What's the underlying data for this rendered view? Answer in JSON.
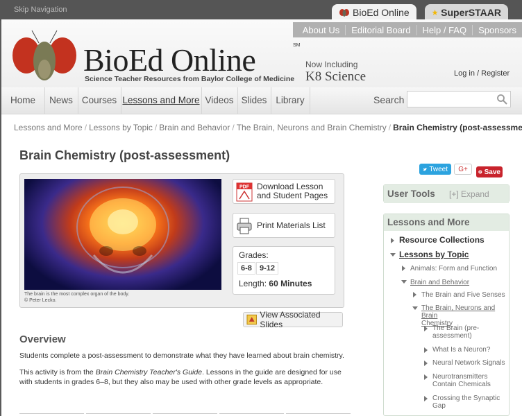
{
  "topbar": {
    "skip_nav": "Skip Navigation",
    "tab_bioed": "BioEd Online",
    "tab_staar": "SuperSTAAR"
  },
  "utility_nav": [
    "About Us",
    "Editorial Board",
    "Help / FAQ",
    "Sponsors"
  ],
  "logo": {
    "title": "BioEd Online",
    "sm": "SM",
    "tagline": "Science Teacher Resources from Baylor College of Medicine",
    "now_including": "Now Including",
    "k8": "K8 Science"
  },
  "auth": {
    "login": "Log in",
    "sep": "/",
    "register": "Register"
  },
  "nav": {
    "items": [
      "Home",
      "News",
      "Courses",
      "Lessons and More",
      "Videos",
      "Slides",
      "Library"
    ],
    "search_label": "Search",
    "search_placeholder": ""
  },
  "breadcrumb": [
    "Lessons and More",
    "Lessons by Topic",
    "Brain and Behavior",
    "The Brain, Neurons and Brain Chemistry",
    "Brain Chemistry (post-assessment)"
  ],
  "page_title": "Brain Chemistry (post-assessment)",
  "social": {
    "tweet": "Tweet",
    "gplus": "G+",
    "save": "Save"
  },
  "lesson": {
    "caption_1": "The brain is the most complex organ of the body.",
    "caption_2": "© Peter Lecko.",
    "download_1": "Download Lesson",
    "download_2": "and Student Pages",
    "pdf_label": "PDF",
    "print": "Print Materials List",
    "grades_label": "Grades:",
    "grades": [
      "6-8",
      "9-12"
    ],
    "length_label": "Length:",
    "length_value": "60 Minutes",
    "slides_button": "View Associated Slides"
  },
  "overview": {
    "title": "Overview",
    "p1": "Students complete a post-assessment to demonstrate what they have learned about brain chemistry.",
    "p2_a": "This activity is from the ",
    "p2_em": "Brain Chemistry Teacher's Guide",
    "p2_b": ". Lessons in the guide are designed for use with students in grades 6–8, but they also may be used with other grade levels as appropriate."
  },
  "sidebar": {
    "tools_title": "User Tools",
    "tools_expand": "[+] Expand",
    "lessons_title": "Lessons and More",
    "tree": {
      "resource_collections": "Resource Collections",
      "lessons_by_topic": "Lessons by Topic",
      "animals": "Animals: Form and Function",
      "brain_behavior": "Brain and Behavior",
      "five_senses": "The Brain and Five Senses",
      "neurons_chem_1": "The Brain, Neurons and Brain",
      "neurons_chem_2": "Chemistry",
      "brain_pre_1": "The Brain (pre-",
      "brain_pre_2": "assessment)",
      "what_neuron": "What Is a Neuron?",
      "neural_signals": "Neural Network Signals",
      "neurotransmitters_1": "Neurotransmitters",
      "neurotransmitters_2": "Contain Chemicals",
      "synaptic_1": "Crossing the Synaptic",
      "synaptic_2": "Gap"
    }
  },
  "colors": {
    "tweet": "#2ca3df",
    "pinterest": "#c8232c",
    "panel_head": "#e3ece3"
  }
}
